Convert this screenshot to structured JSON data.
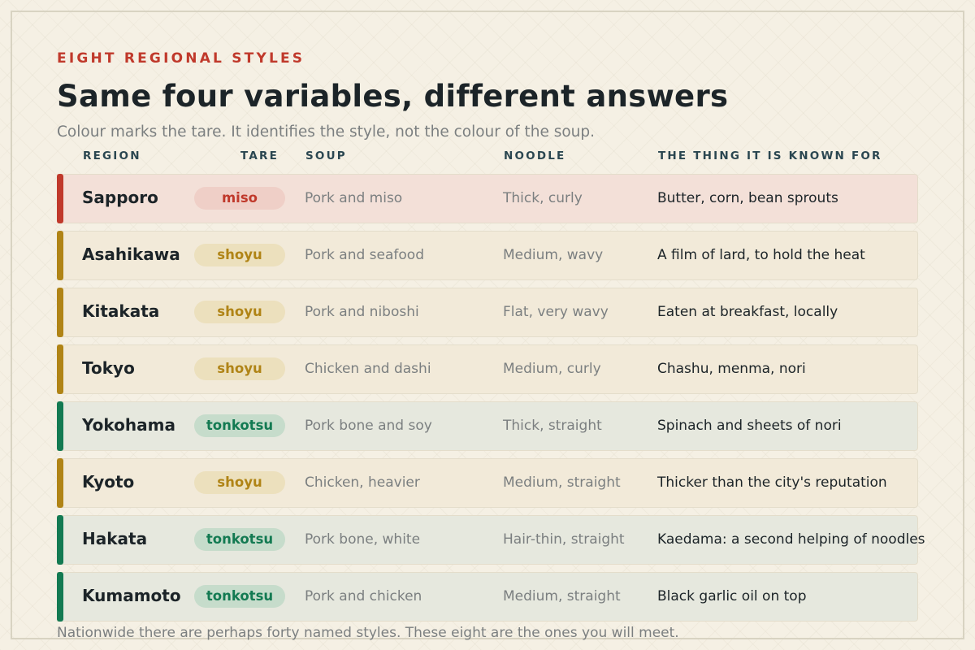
{
  "header": {
    "eyebrow": "EIGHT REGIONAL STYLES",
    "title": "Same four variables, different answers",
    "subtitle": "Colour marks the tare. It identifies the style, not the colour of the soup."
  },
  "columns": {
    "region": "REGION",
    "tare": "TARE",
    "soup": "SOUP",
    "noodle": "NOODLE",
    "known_for": "THE THING IT IS KNOWN FOR"
  },
  "tare_colors": {
    "miso": {
      "accent": "#c0392b",
      "row_bg": "#f3e0d8",
      "pill_bg": "#efcfc7"
    },
    "shoyu": {
      "accent": "#b08416",
      "row_bg": "#f2ead9",
      "pill_bg": "#ece0bd"
    },
    "tonkotsu": {
      "accent": "#137a52",
      "row_bg": "#e6e8de",
      "pill_bg": "#c6dccb"
    }
  },
  "rows": [
    {
      "region": "Sapporo",
      "tare": "miso",
      "soup": "Pork and miso",
      "noodle": "Thick, curly",
      "known_for": "Butter, corn, bean sprouts"
    },
    {
      "region": "Asahikawa",
      "tare": "shoyu",
      "soup": "Pork and seafood",
      "noodle": "Medium, wavy",
      "known_for": "A film of lard, to hold the heat"
    },
    {
      "region": "Kitakata",
      "tare": "shoyu",
      "soup": "Pork and niboshi",
      "noodle": "Flat, very wavy",
      "known_for": "Eaten at breakfast, locally"
    },
    {
      "region": "Tokyo",
      "tare": "shoyu",
      "soup": "Chicken and dashi",
      "noodle": "Medium, curly",
      "known_for": "Chashu, menma, nori"
    },
    {
      "region": "Yokohama",
      "tare": "tonkotsu",
      "soup": "Pork bone and soy",
      "noodle": "Thick, straight",
      "known_for": "Spinach and sheets of nori"
    },
    {
      "region": "Kyoto",
      "tare": "shoyu",
      "soup": "Chicken, heavier",
      "noodle": "Medium, straight",
      "known_for": "Thicker than the city's reputation"
    },
    {
      "region": "Hakata",
      "tare": "tonkotsu",
      "soup": "Pork bone, white",
      "noodle": "Hair-thin, straight",
      "known_for": "Kaedama: a second helping of noodles"
    },
    {
      "region": "Kumamoto",
      "tare": "tonkotsu",
      "soup": "Pork and chicken",
      "noodle": "Medium, straight",
      "known_for": "Black garlic oil on top"
    }
  ],
  "footer": "Nationwide there are perhaps forty named styles. These eight are the ones you will meet."
}
